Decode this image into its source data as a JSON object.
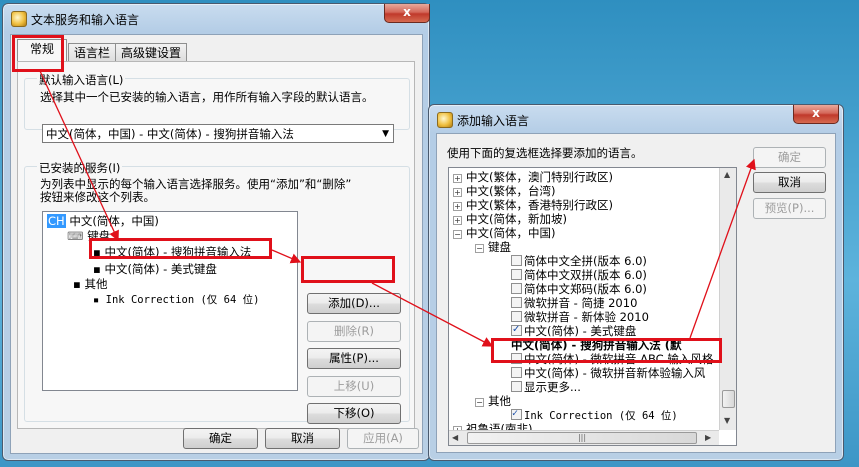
{
  "main_window": {
    "title": "文本服务和输入语言",
    "close_glyph": "x",
    "tabs": [
      {
        "label": "常规",
        "active": true
      },
      {
        "label": "语言栏",
        "active": false
      },
      {
        "label": "高级键设置",
        "active": false
      }
    ],
    "default_language": {
      "group_label": "默认输入语言(L)",
      "description": "选择其中一个已安装的输入语言，用作所有输入字段的默认语言。",
      "selected": "中文(简体，中国) - 中文(简体) - 搜狗拼音输入法"
    },
    "installed_services": {
      "group_label": "已安装的服务(I)",
      "description_line1": "为列表中显示的每个输入语言选择服务。使用“添加”和“删除”",
      "description_line2": "按钮来修改这个列表。",
      "tree": {
        "language_badge": "CH",
        "language": "中文(简体，中国)",
        "keyboard_group": "键盘",
        "keyboard_items": [
          "中文(简体) - 搜狗拼音输入法",
          "中文(简体) - 美式键盘"
        ],
        "other_group": "其他",
        "other_items": [
          "Ink Correction (仅 64 位)"
        ]
      },
      "buttons": {
        "add": "添加(D)...",
        "remove": "删除(R)",
        "properties": "属性(P)...",
        "move_up": "上移(U)",
        "move_down": "下移(O)"
      }
    },
    "footer": {
      "ok": "确定",
      "cancel": "取消",
      "apply": "应用(A)"
    }
  },
  "add_window": {
    "title": "添加输入语言",
    "close_glyph": "x",
    "description": "使用下面的复选框选择要添加的语言。",
    "buttons": {
      "ok": "确定",
      "cancel": "取消",
      "preview": "预览(P)..."
    },
    "tree": {
      "collapsed_languages": [
        "中文(繁体，澳门特别行政区)",
        "中文(繁体，台湾)",
        "中文(繁体，香港特别行政区)",
        "中文(简体，新加坡)"
      ],
      "expanded_language": "中文(简体，中国)",
      "keyboard_group": "键盘",
      "keyboard_items": [
        {
          "label": "简体中文全拼(版本 6.0)",
          "checked": false
        },
        {
          "label": "简体中文双拼(版本 6.0)",
          "checked": false
        },
        {
          "label": "简体中文郑码(版本 6.0)",
          "checked": false
        },
        {
          "label": "微软拼音 - 简捷 2010",
          "checked": false
        },
        {
          "label": "微软拼音 - 新体验 2010",
          "checked": false
        },
        {
          "label": "中文(简体) - 美式键盘",
          "checked": true
        }
      ],
      "bold_item": "中文(简体) - 搜狗拼音输入法 (默",
      "highlighted_item": {
        "label": "中文(简体) - 微软拼音 ABC 输入风格",
        "checked": false
      },
      "after_items": [
        {
          "label": "中文(简体) - 微软拼音新体验输入风",
          "checked": false
        },
        {
          "label": "显示更多...",
          "checked": false
        }
      ],
      "other_group": "其他",
      "other_items": [
        {
          "label": "Ink Correction (仅 64 位)",
          "checked": true
        }
      ],
      "next_language": "祖鲁语(南非)",
      "hscroll_grip": "|||"
    }
  },
  "colors": {
    "annotation_red": "#e0101a",
    "selection_blue": "#3399ff"
  }
}
